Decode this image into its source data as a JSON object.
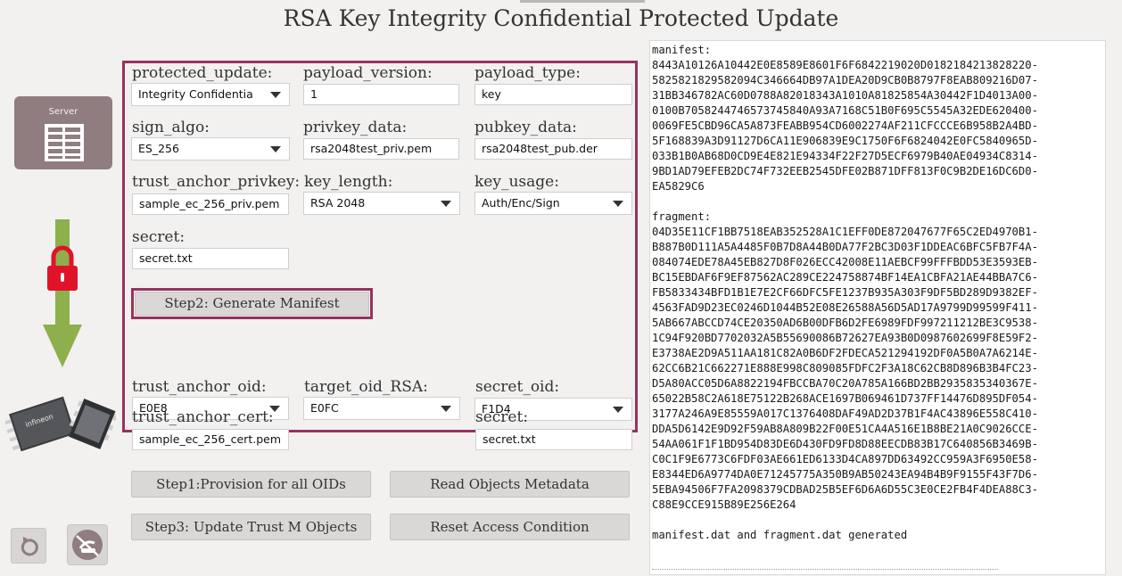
{
  "window": {
    "title": "RSA Key Integrity Confidential Protected Update"
  },
  "sidebar": {
    "server_label": "Server"
  },
  "form": {
    "protected_update": {
      "label": "protected_update:",
      "value": "Integrity Confidentia"
    },
    "payload_version": {
      "label": "payload_version:",
      "value": "1"
    },
    "payload_type": {
      "label": "payload_type:",
      "value": "key"
    },
    "sign_algo": {
      "label": "sign_algo:",
      "value": "ES_256"
    },
    "privkey_data": {
      "label": "privkey_data:",
      "value": "rsa2048test_priv.pem"
    },
    "pubkey_data": {
      "label": "pubkey_data:",
      "value": "rsa2048test_pub.der"
    },
    "trust_anchor_privkey": {
      "label": "trust_anchor_privkey:",
      "value": "sample_ec_256_priv.pem"
    },
    "key_length": {
      "label": "key_length:",
      "value": "RSA 2048"
    },
    "key_usage": {
      "label": "key_usage:",
      "value": "Auth/Enc/Sign"
    },
    "secret_top": {
      "label": "secret:",
      "value": "secret.txt"
    },
    "generate_manifest_label": "Step2: Generate Manifest",
    "trust_anchor_oid": {
      "label": "trust_anchor_oid:",
      "value": "E0E8"
    },
    "target_oid_rsa": {
      "label": "target_oid_RSA:",
      "value": "E0FC"
    },
    "secret_oid": {
      "label": "secret_oid:",
      "value": "F1D4"
    },
    "trust_anchor_cert": {
      "label": "trust_anchor_cert:",
      "value": "sample_ec_256_cert.pem"
    },
    "secret_bottom": {
      "label": "secret:",
      "value": "secret.txt"
    }
  },
  "actions": {
    "provision_label": "Step1:Provision for all OIDs",
    "read_metadata_label": "Read Objects Metadata",
    "update_label": "Step3: Update Trust M Objects",
    "reset_access_label": "Reset Access Condition"
  },
  "log": {
    "text": "manifest:\n8443A10126A10442E0E8589E8601F6F6842219020D0182184213828220-\n5825821829582094C346664DB97A1DEA20D9CB0B8797F8EAB809216D07-\n31BB346782AC60D0788A82018343A1010A81825854A30442F1D4013A00-\n0100B7058244746573745840A93A7168C51B0F695C5545A32EDE620400-\n0069FE5CBD96CA5A873FEABB954CD6002274AF211CFCCCE6B958B2A4BD-\n5F168839A3D91127D6CA11E906839E9C1750F6F6824042E0FC5840965D-\n033B1B0AB68D0CD9E4E821E94334F22F27D5ECF6979B40AE04934C8314-\n9BD1AD79EFEB2DC74F732EEB2545DFE02B871DFF813F0C9B2DE16DC6D0-\nEA5829C6\n\nfragment:\n04D35E11CF1BB7518EAB352528A1C1EFF0DE872047677F65C2ED4970B1-\nB887B0D111A5A4485F0B7D8A44B0DA77F2BC3D03F1DDEAC6BFC5FB7F4A-\n084074EDE78A45EB827D8F026ECC42008E11AEBCF99FFFBDD53E3593EB-\nBC15EBDAF6F9EF87562AC289CE224758874BF14EA1CBFA21AE44BBA7C6-\nFB5833434BFD1B1E7E2CF66DFC5FE1237B935A303F9DF5BD289D9382EF-\n4563FAD9D23EC0246D1044B52E08E26588A56D5AD17A9799D99599F411-\n5AB667ABCCD74CE20350AD6B00DFB6D2FE6989FDF997211212BE3C9538-\n1C94F920BD7702032A5B55690086B72627EA93B0D0987602699F8E59F2-\nE3738AE2D9A511AA181C82A0B6DF2FDECA521294192DF0A5B0A7A6214E-\n62CC6B21C662271E888E998C809085FDFC2F3A18C62CB8D896B3B4FC23-\nD5A80ACC05D6A8822194FBCCBA70C20A785A166BD2BB2935835340367E-\n65022B58C2A618E75122B268ACE1697B069461D737FF14476D895DF054-\n3177A246A9E85559A017C1376408DAF49AD2D37B1F4AC43896E558C410-\nDDA5D6142E9D92F59AB8A809B22F00E51CA4A516E1B8BE21A0C9026CCE-\n54AA061F1F1BD954D83DE6D430FD9FD8D88EECDB83B17C640856B3469B-\nC0C1F9E6773C6FDF03AE661ED6133D4CA897DD63492CC959A3F6950E58-\nE8344ED6A9774DA0E71245775A350B9AB50243EA94B4B9F9155F43F7D6-\n5EBA94506F7FA2098379CDBAD25B5EF6D6A6D55C3E0CE2FB4F4DEA88C3-\nC88E9CCE915B89E256E264\n\nmanifest.dat and fragment.dat generated"
  },
  "colors": {
    "accent_frame": "#97325e",
    "server_card": "#8f7d80",
    "arrow_green": "#8db04c",
    "lock_red": "#e0132a"
  }
}
